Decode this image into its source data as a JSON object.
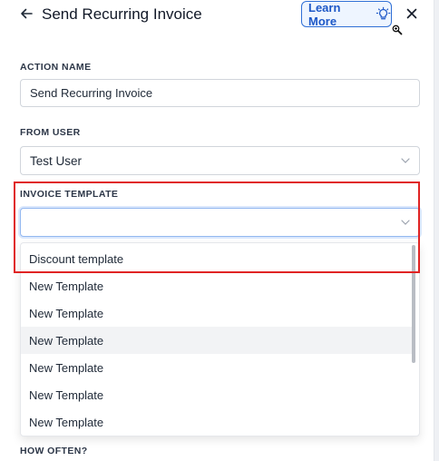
{
  "header": {
    "title": "Send Recurring Invoice",
    "learn_more_label": "Learn More",
    "back_icon": "arrow-left-icon",
    "close_icon": "close-icon",
    "learn_more_icon": "lightbulb-icon"
  },
  "form": {
    "action_name": {
      "label": "ACTION NAME",
      "value": "Send Recurring Invoice"
    },
    "from_user": {
      "label": "FROM USER",
      "value": "Test User"
    },
    "invoice_template": {
      "label": "INVOICE TEMPLATE",
      "value": "",
      "options": [
        "Discount template",
        "New Template",
        "New Template",
        "New Template",
        "New Template",
        "New Template",
        "New Template"
      ],
      "hovered_index": 3
    },
    "how_often": {
      "label": "HOW OFTEN?"
    }
  },
  "colors": {
    "accent": "#1e58c7",
    "highlight": "#e02424",
    "hover_bg": "#f2f3f5"
  }
}
